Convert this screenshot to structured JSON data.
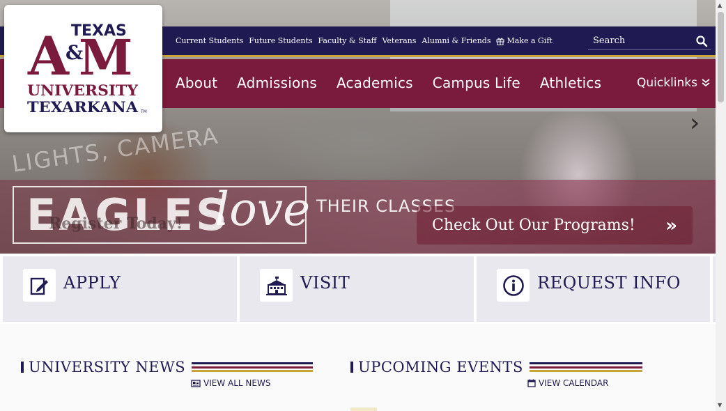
{
  "logo": {
    "line1": "TEXAS",
    "am_a": "A",
    "am_amp": "&",
    "am_m": "M",
    "line2": "UNIVERSITY",
    "line3": "TEXARKANA",
    "tm": "TM"
  },
  "utility_nav": {
    "items": [
      "Current Students",
      "Future Students",
      "Faculty & Staff",
      "Veterans",
      "Alumni & Friends"
    ],
    "gift_label": "Make a Gift"
  },
  "search": {
    "placeholder": "Search"
  },
  "main_nav": {
    "items": [
      "About",
      "Admissions",
      "Academics",
      "Campus Life",
      "Athletics"
    ],
    "quicklinks_label": "Quicklinks"
  },
  "hero": {
    "caption_text": "LIGHTS, CAMERA",
    "banner_eagles": "EAGLES",
    "banner_love": "love",
    "banner_their": "THEIR CLASSES",
    "banner_register": "Register Today!",
    "programs_button": "Check Out Our Programs!"
  },
  "cta": {
    "apply": "APPLY",
    "visit": "VISIT",
    "request_info": "REQUEST INFO"
  },
  "news": {
    "title": "UNIVERSITY NEWS",
    "view_all": "VIEW ALL NEWS"
  },
  "events": {
    "title": "UPCOMING EVENTS",
    "view_calendar": "VIEW CALENDAR"
  },
  "colors": {
    "navy": "#1f1b52",
    "maroon": "#7a1a3c",
    "gold": "#c9a43a",
    "cta_bg": "#e9e8ee"
  },
  "icons": {
    "apply": "edit-document-icon",
    "visit": "school-building-icon",
    "request_info": "info-circle-icon",
    "news": "newspaper-icon",
    "calendar": "calendar-icon",
    "search": "search-icon",
    "gift": "gift-icon"
  }
}
